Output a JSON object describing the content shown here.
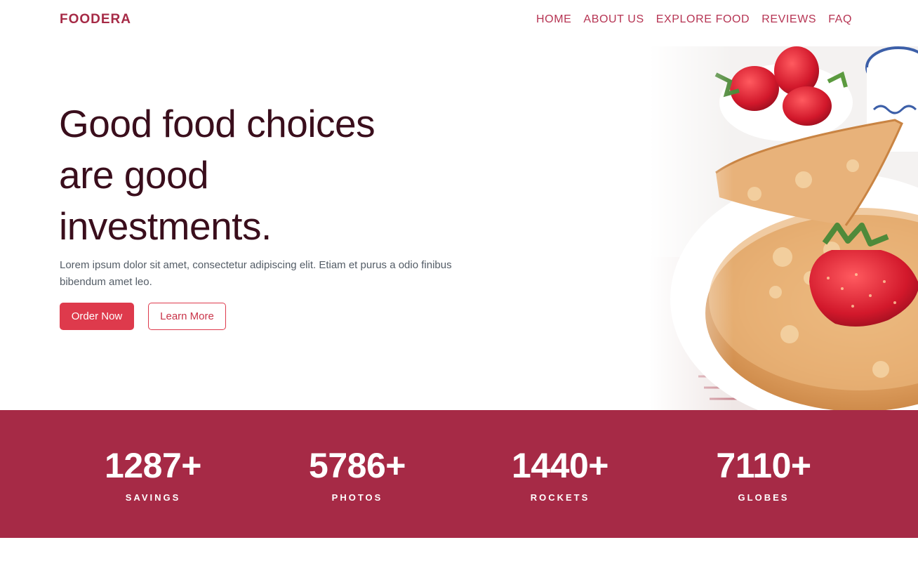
{
  "brand": "FOODERA",
  "nav": {
    "items": [
      "HOME",
      "ABOUT US",
      "EXPLORE FOOD",
      "REVIEWS",
      "FAQ"
    ]
  },
  "hero": {
    "title_line1": "Good food choices",
    "title_line2": "are good",
    "title_line3": "investments.",
    "text": "Lorem ipsum dolor sit amet, consectetur adipiscing elit. Etiam et purus a odio finibus bibendum amet leo.",
    "primary_button": "Order Now",
    "secondary_button": "Learn More",
    "image_icon": "pancakes-strawberries-photo"
  },
  "stats": [
    {
      "value": "1287+",
      "label": "SAVINGS"
    },
    {
      "value": "5786+",
      "label": "PHOTOS"
    },
    {
      "value": "1440+",
      "label": "ROCKETS"
    },
    {
      "value": "7110+",
      "label": "GLOBES"
    }
  ],
  "colors": {
    "brand": "#a62a46",
    "accent": "#de3a4c",
    "heading": "#3a0e1c",
    "body_text": "#535c66",
    "stats_background": "#a62a46"
  }
}
